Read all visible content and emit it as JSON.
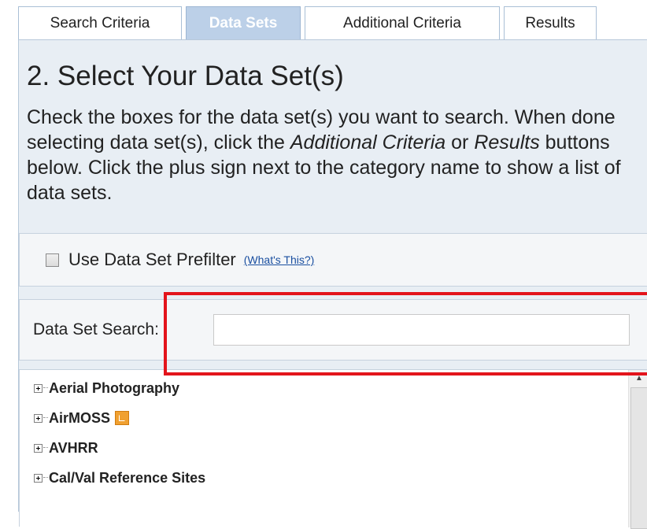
{
  "tabs": [
    {
      "label": "Search Criteria",
      "active": false
    },
    {
      "label": "Data Sets",
      "active": true
    },
    {
      "label": "Additional Criteria",
      "active": false
    },
    {
      "label": "Results",
      "active": false
    }
  ],
  "heading": "2. Select Your Data Set(s)",
  "instructions": {
    "part1": "Check the boxes for the data set(s) you want to search. When done selecting data set(s), click the ",
    "em1": "Additional Criteria",
    "part2": " or ",
    "em2": "Results",
    "part3": " buttons below. Click the plus sign next to the category name to show a list of data sets."
  },
  "prefilter": {
    "label": "Use Data Set Prefilter",
    "help_link": "(What's This?)",
    "checked": false
  },
  "search": {
    "label": "Data Set Search:",
    "value": "",
    "placeholder": ""
  },
  "categories": [
    {
      "label": "Aerial Photography",
      "icon": "plus-expander-icon"
    },
    {
      "label": "AirMOSS",
      "icon": "plus-expander-icon",
      "badge": "new-data-icon"
    },
    {
      "label": "AVHRR",
      "icon": "plus-expander-icon"
    },
    {
      "label": "Cal/Val Reference Sites",
      "icon": "plus-expander-icon"
    }
  ],
  "colors": {
    "active_tab": "#bcd0e8",
    "panel_bg": "#e8eef4",
    "link": "#1a4fa0",
    "highlight": "#e3141b",
    "badge": "#f0a030"
  }
}
